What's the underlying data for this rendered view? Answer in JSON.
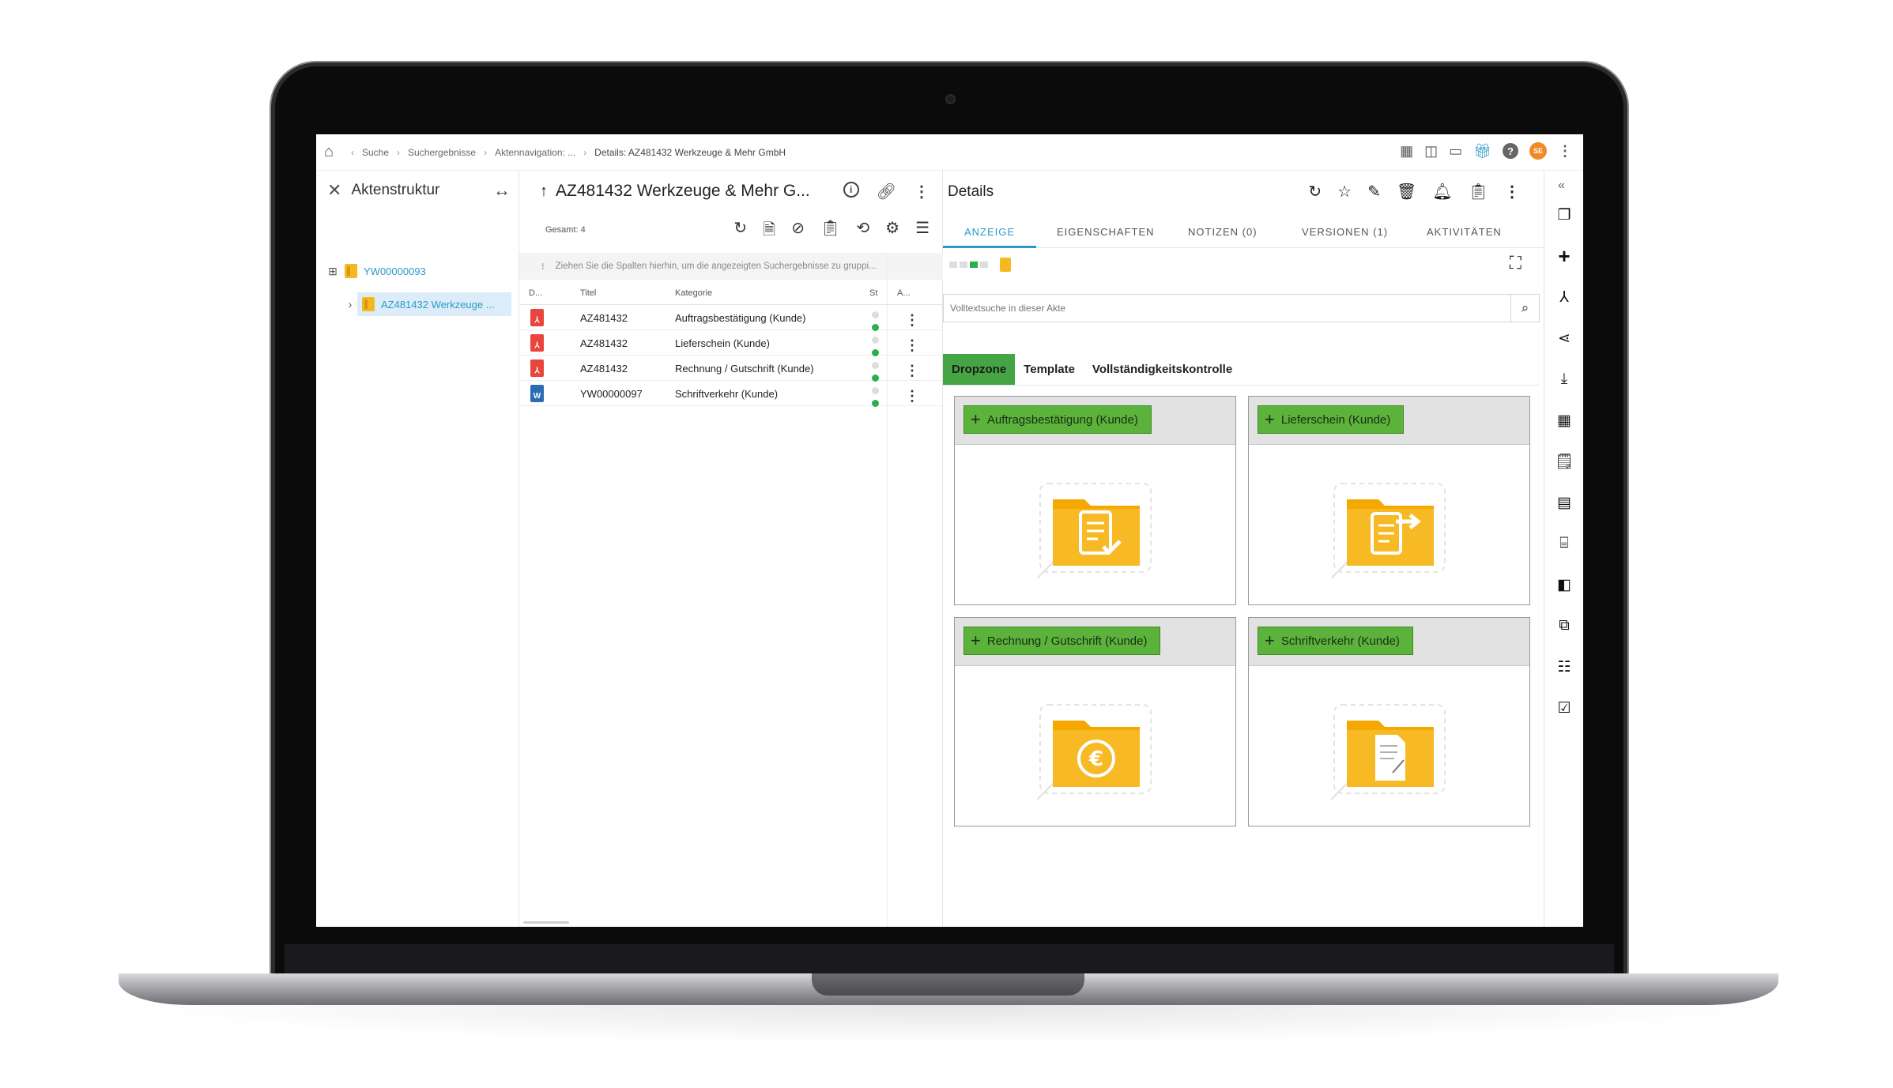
{
  "breadcrumb": {
    "items": [
      "Suche",
      "Suchergebnisse",
      "Aktennavigation: ...",
      "Details: AZ481432 Werkzeuge & Mehr GmbH"
    ],
    "back_glyph": "‹",
    "separator": "›"
  },
  "user": {
    "initials": "SE"
  },
  "left_pane": {
    "title": "Aktenstruktur",
    "tree": [
      {
        "label": "YW00000093",
        "expand": "⊞"
      },
      {
        "label": "AZ481432 Werkzeuge ...",
        "expand": "›",
        "selected": true
      }
    ]
  },
  "list_pane": {
    "title": "AZ481432 Werkzeuge & Mehr G...",
    "total": "Gesamt: 4",
    "group_hint": "Ziehen Sie die Spalten hierhin, um die angezeigten Suchergebnisse zu gruppi...",
    "columns": [
      "D...",
      "Titel",
      "Kategorie",
      "St",
      "A..."
    ],
    "rows": [
      {
        "type": "pdf",
        "title": "AZ481432",
        "category": "Auftragsbestätigung (Kunde)"
      },
      {
        "type": "pdf",
        "title": "AZ481432",
        "category": "Lieferschein (Kunde)"
      },
      {
        "type": "pdf",
        "title": "AZ481432",
        "category": "Rechnung / Gutschrift (Kunde)"
      },
      {
        "type": "word",
        "title": "YW00000097",
        "category": "Schriftverkehr (Kunde)"
      }
    ]
  },
  "details": {
    "title": "Details",
    "tabs": [
      "ANZEIGE",
      "EIGENSCHAFTEN",
      "NOTIZEN (0)",
      "VERSIONEN (1)",
      "AKTIVITÄTEN"
    ],
    "active_tab": "ANZEIGE",
    "search_placeholder": "Volltextsuche in dieser Akte",
    "subtabs": [
      "Dropzone",
      "Template",
      "Vollständigkeitskontrolle"
    ],
    "active_subtab": "Dropzone",
    "dropzones": [
      {
        "label": "Auftragsbestätigung (Kunde)",
        "icon": "folder-check-icon"
      },
      {
        "label": "Lieferschein (Kunde)",
        "icon": "folder-forward-icon"
      },
      {
        "label": "Rechnung / Gutschrift (Kunde)",
        "icon": "folder-euro-icon"
      },
      {
        "label": "Schriftverkehr (Kunde)",
        "icon": "folder-letter-icon"
      }
    ]
  },
  "colors": {
    "accent": "#2a9ac9",
    "success": "#45a443",
    "folder": "#f5b81f",
    "pdf": "#e8453c",
    "word": "#2b6cb5"
  }
}
